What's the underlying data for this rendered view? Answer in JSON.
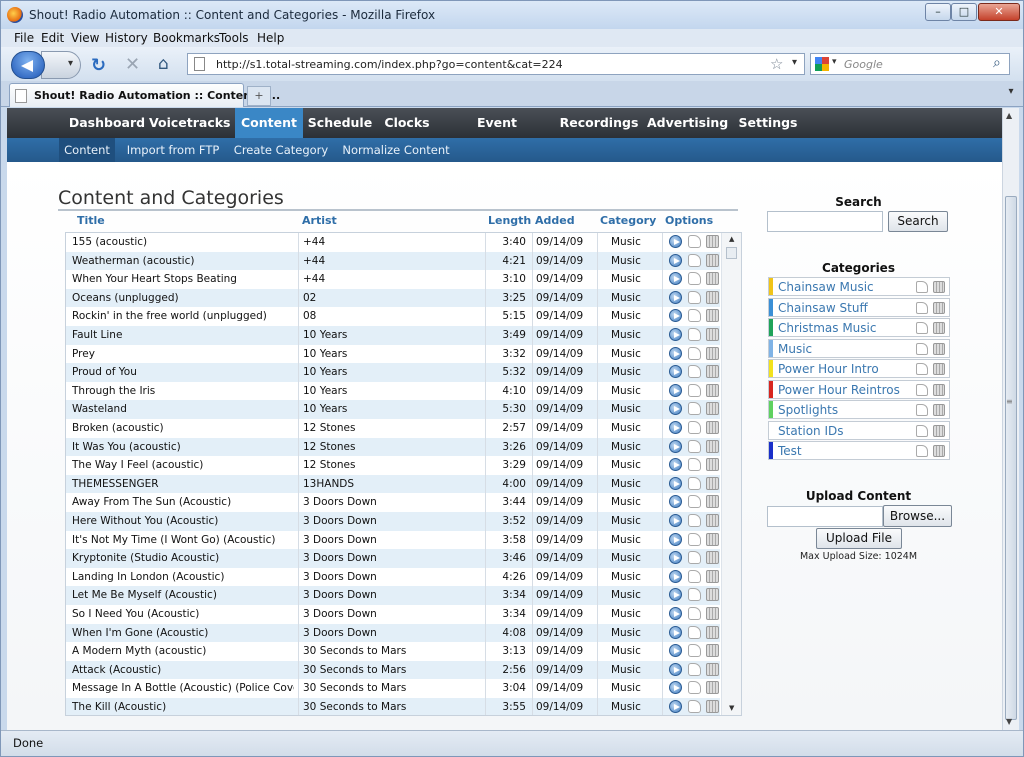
{
  "window": {
    "title": "Shout! Radio Automation :: Content and Categories - Mozilla Firefox",
    "min": "–",
    "max": "□",
    "close": "✕"
  },
  "menu": [
    "File",
    "Edit",
    "View",
    "History",
    "Bookmarks",
    "Tools",
    "Help"
  ],
  "nav": {
    "url": "http://s1.total-streaming.com/index.php?go=content&cat=224",
    "search_placeholder": "Google"
  },
  "tab": {
    "title": "Shout! Radio Automation :: Content a...",
    "new_tab": "+"
  },
  "main_nav": [
    {
      "label": "Dashboard",
      "active": false
    },
    {
      "label": "Voicetracks",
      "active": false
    },
    {
      "label": "Content",
      "active": true
    },
    {
      "label": "Schedule",
      "active": false
    },
    {
      "label": "Clocks",
      "active": false
    },
    {
      "label": "Event Scheduler",
      "active": false
    },
    {
      "label": "Recordings",
      "active": false
    },
    {
      "label": "Advertising",
      "active": false
    },
    {
      "label": "Settings",
      "active": false
    }
  ],
  "sub_nav": [
    {
      "label": "Content",
      "active": true
    },
    {
      "label": "Import from FTP",
      "active": false
    },
    {
      "label": "Create Category",
      "active": false
    },
    {
      "label": "Normalize Content",
      "active": false
    }
  ],
  "content": {
    "heading": "Content and Categories",
    "columns": [
      "Title",
      "Artist",
      "Length",
      "Added",
      "Category",
      "Options"
    ],
    "rows": [
      [
        "155 (acoustic)",
        "+44",
        "3:40",
        "09/14/09",
        "Music"
      ],
      [
        "Weatherman (acoustic)",
        "+44",
        "4:21",
        "09/14/09",
        "Music"
      ],
      [
        "When Your Heart Stops Beating",
        "+44",
        "3:10",
        "09/14/09",
        "Music"
      ],
      [
        "Oceans (unplugged)",
        "02",
        "3:25",
        "09/14/09",
        "Music"
      ],
      [
        "Rockin' in the free world (unplugged)",
        "08",
        "5:15",
        "09/14/09",
        "Music"
      ],
      [
        "Fault Line",
        "10 Years",
        "3:49",
        "09/14/09",
        "Music"
      ],
      [
        "Prey",
        "10 Years",
        "3:32",
        "09/14/09",
        "Music"
      ],
      [
        "Proud of You",
        "10 Years",
        "5:32",
        "09/14/09",
        "Music"
      ],
      [
        "Through the Iris",
        "10 Years",
        "4:10",
        "09/14/09",
        "Music"
      ],
      [
        "Wasteland",
        "10 Years",
        "5:30",
        "09/14/09",
        "Music"
      ],
      [
        "Broken (acoustic)",
        "12 Stones",
        "2:57",
        "09/14/09",
        "Music"
      ],
      [
        "It Was You (acoustic)",
        "12 Stones",
        "3:26",
        "09/14/09",
        "Music"
      ],
      [
        "The Way I Feel (acoustic)",
        "12 Stones",
        "3:29",
        "09/14/09",
        "Music"
      ],
      [
        "THEMESSENGER",
        "13HANDS",
        "4:00",
        "09/14/09",
        "Music"
      ],
      [
        "Away From The Sun (Acoustic)",
        "3 Doors Down",
        "3:44",
        "09/14/09",
        "Music"
      ],
      [
        "Here Without You (Acoustic)",
        "3 Doors Down",
        "3:52",
        "09/14/09",
        "Music"
      ],
      [
        "It's Not My Time (I Wont Go) (Acoustic)",
        "3 Doors Down",
        "3:58",
        "09/14/09",
        "Music"
      ],
      [
        "Kryptonite (Studio Acoustic)",
        "3 Doors Down",
        "3:46",
        "09/14/09",
        "Music"
      ],
      [
        "Landing In London (Acoustic)",
        "3 Doors Down",
        "4:26",
        "09/14/09",
        "Music"
      ],
      [
        "Let Me Be Myself (Acoustic)",
        "3 Doors Down",
        "3:34",
        "09/14/09",
        "Music"
      ],
      [
        "So I Need You (Acoustic)",
        "3 Doors Down",
        "3:34",
        "09/14/09",
        "Music"
      ],
      [
        "When I'm Gone (Acoustic)",
        "3 Doors Down",
        "4:08",
        "09/14/09",
        "Music"
      ],
      [
        "A Modern Myth (acoustic)",
        "30 Seconds to Mars",
        "3:13",
        "09/14/09",
        "Music"
      ],
      [
        "Attack (Acoustic)",
        "30 Seconds to Mars",
        "2:56",
        "09/14/09",
        "Music"
      ],
      [
        "Message In A Bottle (Acoustic) (Police Cover)",
        "30 Seconds to Mars",
        "3:04",
        "09/14/09",
        "Music"
      ],
      [
        "The Kill (Acoustic)",
        "30 Seconds to Mars",
        "3:55",
        "09/14/09",
        "Music"
      ]
    ]
  },
  "sidebar": {
    "search_title": "Search",
    "search_button": "Search",
    "categories_title": "Categories",
    "categories": [
      {
        "label": "Chainsaw Music",
        "color": "#f0c419"
      },
      {
        "label": "Chainsaw Stuff",
        "color": "#3a8fd6"
      },
      {
        "label": "Christmas Music",
        "color": "#1fa35a"
      },
      {
        "label": "Music",
        "color": "#7fb3e6"
      },
      {
        "label": "Power Hour Intro",
        "color": "#f2e21d"
      },
      {
        "label": "Power Hour Reintros",
        "color": "#d8261f"
      },
      {
        "label": "Spotlights",
        "color": "#5fd160"
      },
      {
        "label": "Station IDs",
        "color": "#ffffff"
      },
      {
        "label": "Test",
        "color": "#1a2fc9"
      }
    ],
    "upload_title": "Upload Content",
    "browse_button": "Browse...",
    "upload_button": "Upload File",
    "max_upload": "Max Upload Size: 1024M"
  },
  "status": "Done"
}
